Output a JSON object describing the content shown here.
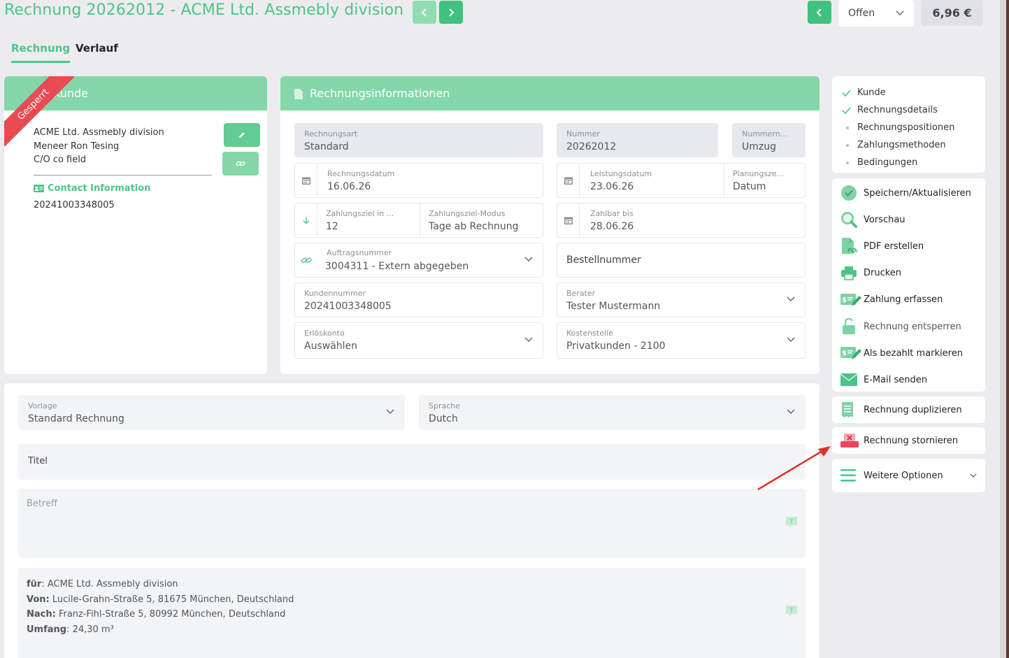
{
  "header": {
    "title": "Rechnung 20262012 - ACME Ltd. Assmebly division",
    "status": "Offen",
    "amount": "6,96 €"
  },
  "tabs": [
    {
      "label": "Rechnung"
    },
    {
      "label": "Verlauf"
    }
  ],
  "customer_card": {
    "title": "Kunde",
    "ribbon": "Gesperrt",
    "lines": [
      "ACME Ltd. Assmebly division",
      "Meneer Ron Tesing",
      "C/O co field"
    ],
    "contact_label": "Contact Information",
    "contact_value": "20241003348005"
  },
  "invoice_info": {
    "title": "Rechnungsinformationen",
    "fields": {
      "rechnungsart": {
        "label": "Rechnungsart",
        "value": "Standard"
      },
      "nummer": {
        "label": "Nummer",
        "value": "20262012"
      },
      "nummernkreis": {
        "label": "Nummern...",
        "value": "Umzug"
      },
      "rechnungsdatum": {
        "label": "Rechnungsdatum",
        "value": "16.06.26"
      },
      "leistungsdatum": {
        "label": "Leistungsdatum",
        "value": "23.06.26"
      },
      "planungszeitraum": {
        "label": "Planungsze...",
        "value": "Datum"
      },
      "zahlungsziel": {
        "label": "Zahlungsziel in ...",
        "value": "12"
      },
      "zahlungsziel_modus": {
        "label": "Zahlungsziel-Modus",
        "value": "Tage ab Rechnung"
      },
      "zahlbar_bis": {
        "label": "Zahlbar bis",
        "value": "28.06.26"
      },
      "auftragsnummer": {
        "label": "Auftragsnummer",
        "value": "3004311 - Extern abgegeben"
      },
      "bestellnummer": {
        "placeholder": "Bestellnummer"
      },
      "kundennummer": {
        "label": "Kundennummer",
        "value": "20241003348005"
      },
      "berater": {
        "label": "Berater",
        "value": "Tester Mustermann"
      },
      "erloeskonto": {
        "label": "Erlöskonto",
        "value": "Auswählen"
      },
      "kostenstelle": {
        "label": "Kostenstelle",
        "value": "Privatkunden - 2100"
      }
    }
  },
  "document": {
    "vorlage": {
      "label": "Vorlage",
      "value": "Standard Rechnung"
    },
    "sprache": {
      "label": "Sprache",
      "value": "Dutch"
    },
    "titel_placeholder": "Titel",
    "betreff_placeholder": "Betreff",
    "body": [
      {
        "key": "für",
        "value": ": ACME Ltd. Assmebly division"
      },
      {
        "key": "Von:",
        "value": " Lucile-Grahn-Straße 5, 81675 München, Deutschland"
      },
      {
        "key": "Nach:",
        "value": " Franz-Fihl-Straße 5, 80992 München, Deutschland"
      },
      {
        "key": "Umfang",
        "value": ": 24,30 m³"
      }
    ]
  },
  "sidebar": {
    "steps": [
      {
        "label": "Kunde",
        "done": true
      },
      {
        "label": "Rechnungsdetails",
        "done": true
      },
      {
        "label": "Rechnungspositionen",
        "done": false
      },
      {
        "label": "Zahlungsmethoden",
        "done": false
      },
      {
        "label": "Bedingungen",
        "done": false
      }
    ],
    "actions": [
      {
        "label": "Speichern/Aktualisieren",
        "icon": "check-circle-icon"
      },
      {
        "label": "Vorschau",
        "icon": "magnifier-icon"
      },
      {
        "label": "PDF erstellen",
        "icon": "pdf-icon"
      },
      {
        "label": "Drucken",
        "icon": "printer-icon"
      },
      {
        "label": "Zahlung erfassen",
        "icon": "payment-icon"
      },
      {
        "label": "Rechnung entsperren",
        "icon": "unlock-icon"
      },
      {
        "label": "Als bezahlt markieren",
        "icon": "payment-icon"
      },
      {
        "label": "E-Mail senden",
        "icon": "envelope-icon"
      }
    ],
    "duplicate": "Rechnung duplizieren",
    "cancel": "Rechnung stornieren",
    "more": "Weitere Optionen"
  },
  "colors": {
    "accent": "#4cc488",
    "header_green": "#83d7a9",
    "ribbon_red": "#ea4b52",
    "arrow_red": "#d9342b"
  }
}
